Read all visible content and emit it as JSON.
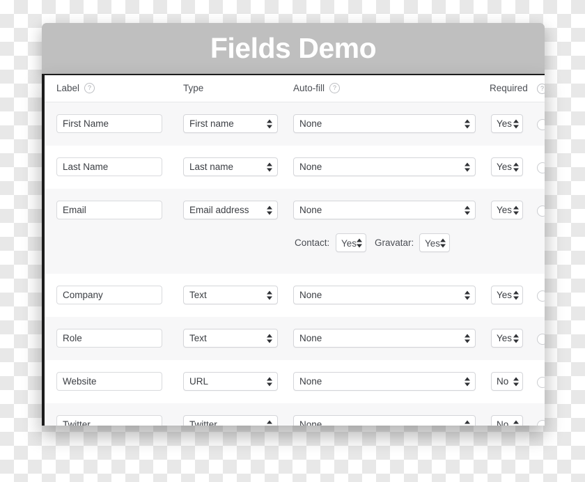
{
  "window": {
    "title": "Fields Demo"
  },
  "table": {
    "headers": {
      "label": "Label",
      "type": "Type",
      "autofill": "Auto-fill",
      "required": "Required",
      "help_glyph": "?"
    },
    "rows": [
      {
        "label_value": "First Name",
        "type_value": "First name",
        "autofill_value": "None",
        "required_value": "Yes"
      },
      {
        "label_value": "Last Name",
        "type_value": "Last name",
        "autofill_value": "None",
        "required_value": "Yes"
      },
      {
        "label_value": "Email",
        "type_value": "Email address",
        "autofill_value": "None",
        "required_value": "Yes",
        "extra": {
          "contact_label": "Contact:",
          "contact_value": "Yes",
          "gravatar_label": "Gravatar:",
          "gravatar_value": "Yes"
        }
      },
      {
        "label_value": "Company",
        "type_value": "Text",
        "autofill_value": "None",
        "required_value": "Yes"
      },
      {
        "label_value": "Role",
        "type_value": "Text",
        "autofill_value": "None",
        "required_value": "Yes"
      },
      {
        "label_value": "Website",
        "type_value": "URL",
        "autofill_value": "None",
        "required_value": "No"
      },
      {
        "label_value": "Twitter",
        "type_value": "Twitter",
        "autofill_value": "None",
        "required_value": "No"
      }
    ]
  },
  "colors": {
    "titlebar": "#bfbfbf",
    "title_text": "#ffffff",
    "card": "#ffffff",
    "row_alt": "#f7f7f8",
    "text": "#3b3e43",
    "border": "#d9dadd"
  },
  "icons": {
    "help": "help-circle-icon",
    "stepper": "stepper-arrows-icon"
  }
}
